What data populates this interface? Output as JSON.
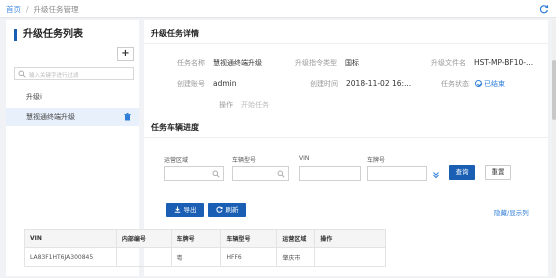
{
  "breadcrumb": {
    "home": "首页",
    "separator": "/",
    "current": "升级任务管理"
  },
  "sidebar": {
    "title": "升级任务列表",
    "add_label": "+",
    "search_placeholder": "输入关键字进行过滤",
    "items": [
      {
        "label": "升级i"
      },
      {
        "label": "慧视通终端升级"
      }
    ]
  },
  "detail": {
    "title": "升级任务详情",
    "fields": {
      "task_name": {
        "label": "任务名称",
        "value": "慧视通终端升级"
      },
      "cmd_type": {
        "label": "升级指令类型",
        "value": "国标"
      },
      "file_name": {
        "label": "升级文件名",
        "value": "HST-MP-BF10-..."
      },
      "creator": {
        "label": "创建账号",
        "value": "admin"
      },
      "created_at": {
        "label": "创建时间",
        "value": "2018-11-02 16:..."
      },
      "status": {
        "label": "任务状态",
        "value": "已结束"
      },
      "operation": {
        "label": "操作",
        "value": "开始任务"
      }
    }
  },
  "vehicles": {
    "title": "任务车辆进度",
    "filters": {
      "region_label": "运营区域",
      "model_label": "车辆型号",
      "vin_label": "VIN",
      "plate_label": "车牌号"
    },
    "search_label": "查询",
    "reset_label": "重置",
    "export_label": "导出",
    "refresh_label": "刷新",
    "toggle_columns_label": "隐藏/显示列",
    "columns": [
      "VIN",
      "内部编号",
      "车牌号",
      "车辆型号",
      "运营区域",
      "操作"
    ],
    "rows": [
      [
        "LA83F1HT6JA300845",
        "",
        "粤",
        "HFF6",
        "肇庆市",
        ""
      ]
    ]
  },
  "colors": {
    "accent": "#1a5fb4",
    "link": "#2f7fd9",
    "status_done": "#2f7fd9"
  }
}
